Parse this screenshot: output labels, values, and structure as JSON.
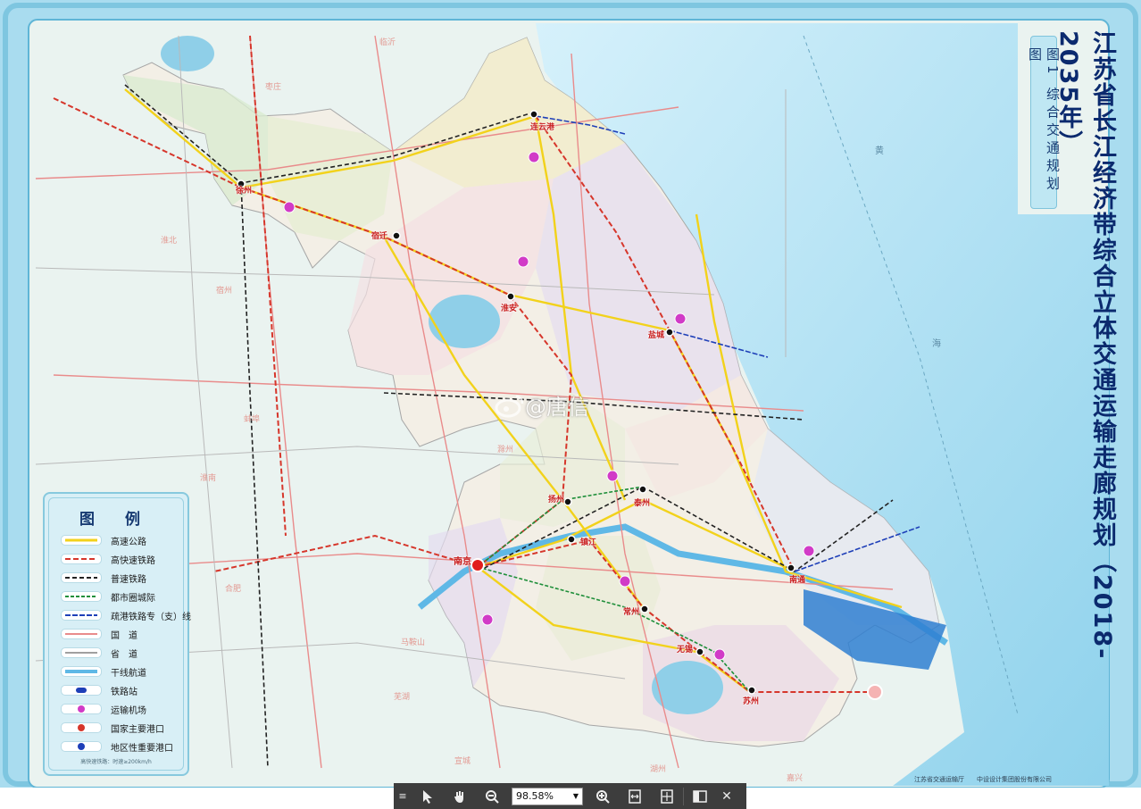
{
  "map": {
    "title": "江苏省长江经济带综合立体交通运输走廊规划（2018-2035年）",
    "subtitle": "图1 综合交通规划图",
    "colors": {
      "sea": "#9fd8ee",
      "land": "#eef3e4",
      "border": "#5fb5d6",
      "expressway": "#f2d21b",
      "hsr": "#d6362b",
      "rail": "#222222",
      "intercity": "#1f8f3a",
      "port_rail": "#1e3fb8",
      "national_road": "#e98b8b",
      "provincial_road": "#bfbfbf",
      "waterway": "#5fb8e6"
    },
    "cities": [
      {
        "name": "徐州"
      },
      {
        "name": "连云港"
      },
      {
        "name": "宿迁"
      },
      {
        "name": "淮安"
      },
      {
        "name": "盐城"
      },
      {
        "name": "扬州"
      },
      {
        "name": "泰州"
      },
      {
        "name": "镇江"
      },
      {
        "name": "南京"
      },
      {
        "name": "常州"
      },
      {
        "name": "南通"
      },
      {
        "name": "无锡"
      },
      {
        "name": "苏州"
      }
    ],
    "neighbors": [
      "临沂",
      "枣庄",
      "淮北",
      "宿州",
      "蚌埠",
      "淮南",
      "合肥",
      "马鞍山",
      "芜湖",
      "宣城",
      "湖州",
      "嘉兴",
      "滁州",
      "黄"
    ],
    "seas": [
      "黄",
      "海"
    ],
    "credits": [
      "江苏省交通运输厅",
      "中设设计集团股份有限公司"
    ]
  },
  "legend": {
    "title": "图 例",
    "items": [
      {
        "label": "高速公路",
        "icon": "expressway-line"
      },
      {
        "label": "高快速铁路",
        "icon": "hsr-line"
      },
      {
        "label": "普速铁路",
        "icon": "rail-line"
      },
      {
        "label": "都市圈城际",
        "icon": "intercity-line"
      },
      {
        "label": "疏港铁路专（支）线",
        "icon": "port-rail-line"
      },
      {
        "label": "国　道",
        "icon": "national-road-line"
      },
      {
        "label": "省　道",
        "icon": "provincial-road-line"
      },
      {
        "label": "干线航道",
        "icon": "waterway-line"
      },
      {
        "label": "铁路站",
        "icon": "rail-station-icon"
      },
      {
        "label": "运输机场",
        "icon": "airport-icon"
      },
      {
        "label": "国家主要港口",
        "icon": "national-port-icon"
      },
      {
        "label": "地区性重要港口",
        "icon": "regional-port-icon"
      }
    ],
    "note": "高快速铁路：时速≥200km/h"
  },
  "watermark": "@唐信",
  "toolbar": {
    "zoom_value": "98.58%",
    "buttons": [
      "menu",
      "select",
      "hand",
      "zoom-out",
      "zoom-in",
      "fit-width",
      "fit-page",
      "panel",
      "close"
    ]
  }
}
